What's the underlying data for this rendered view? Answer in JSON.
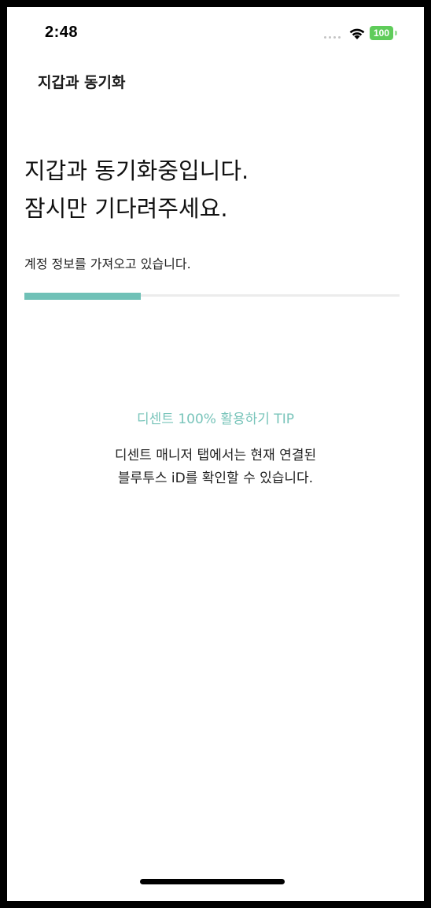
{
  "status_bar": {
    "time": "2:48",
    "battery": "100",
    "battery_color": "#5fcc5a"
  },
  "nav": {
    "title": "지갑과 동기화"
  },
  "main": {
    "headline_line1": "지갑과 동기화중입니다.",
    "headline_line2": "잠시만 기다려주세요.",
    "status_text": "계정 정보를 가져오고 있습니다.",
    "progress_fraction": 0.31,
    "accent_color": "#70c1b7"
  },
  "tip": {
    "title": "디센트 100% 활용하기 TIP",
    "line1": "디센트 매니저 탭에서는 현재 연결된",
    "line2": "블루투스 iD를 확인할 수 있습니다."
  },
  "icons": {
    "signal": "cellular-signal-icon",
    "wifi": "wifi-icon",
    "battery": "battery-icon"
  }
}
